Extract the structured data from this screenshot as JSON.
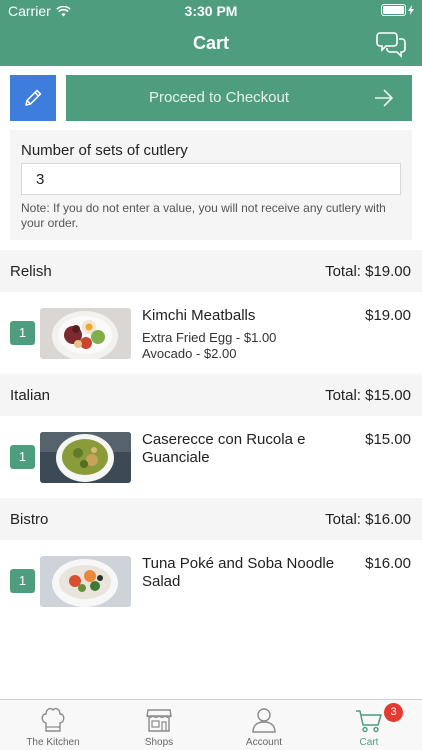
{
  "status_bar": {
    "carrier": "Carrier",
    "time": "3:30 PM"
  },
  "nav": {
    "title": "Cart",
    "chat_icon": "chat-bubbles-icon"
  },
  "actions": {
    "edit_icon": "pencil-icon",
    "checkout_label": "Proceed to Checkout",
    "arrow_icon": "arrow-right-icon"
  },
  "cutlery": {
    "label": "Number of sets of cutlery",
    "value": "3",
    "note": "Note: If you do not enter a value, you will not receive any cutlery with your order."
  },
  "sections": [
    {
      "name": "Relish",
      "total": "Total: $19.00",
      "items": [
        {
          "qty": "1",
          "name": "Kimchi Meatballs",
          "price": "$19.00",
          "options": [
            "Extra Fried Egg - $1.00",
            "Avocado - $2.00"
          ]
        }
      ]
    },
    {
      "name": "Italian",
      "total": "Total: $15.00",
      "items": [
        {
          "qty": "1",
          "name": "Caserecce con Rucola e Guanciale",
          "price": "$15.00",
          "options": []
        }
      ]
    },
    {
      "name": "Bistro",
      "total": "Total: $16.00",
      "items": [
        {
          "qty": "1",
          "name": "Tuna Poké and Soba Noodle Salad",
          "price": "$16.00",
          "options": []
        }
      ]
    }
  ],
  "tabs": [
    {
      "label": "The Kitchen",
      "icon": "chef-hat-icon"
    },
    {
      "label": "Shops",
      "icon": "storefront-icon"
    },
    {
      "label": "Account",
      "icon": "user-icon"
    },
    {
      "label": "Cart",
      "icon": "cart-icon",
      "badge": "3",
      "active": true
    }
  ],
  "colors": {
    "brand_green": "#4e9d7e",
    "edit_blue": "#3e7ddb",
    "badge_red": "#e23b30"
  }
}
